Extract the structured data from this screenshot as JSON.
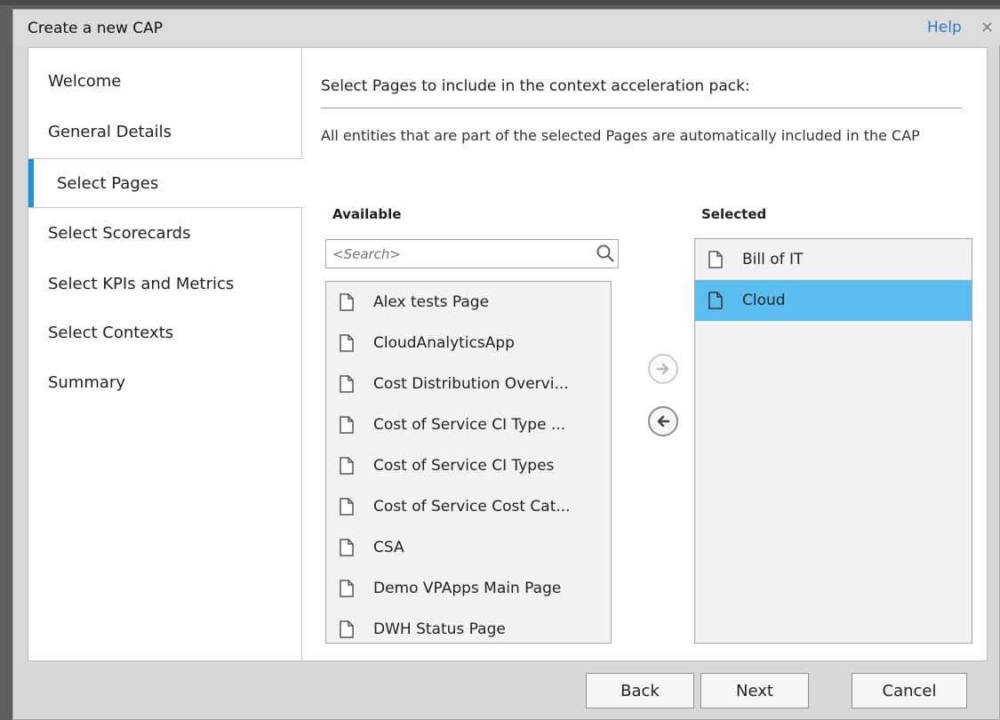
{
  "window": {
    "title": "Create a new CAP",
    "help_label": "Help",
    "close_label": "×"
  },
  "sidebar": {
    "items": [
      {
        "label": "Welcome"
      },
      {
        "label": "General Details"
      },
      {
        "label": "Select Pages"
      },
      {
        "label": "Select Scorecards"
      },
      {
        "label": "Select KPIs and Metrics"
      },
      {
        "label": "Select Contexts"
      },
      {
        "label": "Summary"
      }
    ],
    "active_label": "Select Pages"
  },
  "main": {
    "heading": "Select Pages to include in the context acceleration pack:",
    "note": "All entities that are part of the selected Pages are automatically included in the CAP",
    "available_label": "Available",
    "selected_label": "Selected",
    "search_placeholder": "<Search>",
    "available_items": [
      "Alex tests Page",
      "CloudAnalyticsApp",
      "Cost Distribution Overvi...",
      "Cost of Service CI Type ...",
      "Cost of Service CI Types",
      "Cost of Service Cost Cat...",
      "CSA",
      "Demo VPApps Main Page",
      "DWH Status Page"
    ],
    "selected_items": [
      "Bill of IT",
      "Cloud"
    ],
    "selected_highlight": "Cloud"
  },
  "footer": {
    "back_label": "Back",
    "next_label": "Next",
    "cancel_label": "Cancel"
  },
  "colors": {
    "accent": "#1f8ed8",
    "selection": "#5abff0",
    "link": "#2f77c8"
  },
  "icons": {
    "search": "search-icon",
    "page": "page-icon",
    "add": "arrow-right-icon",
    "remove": "arrow-left-icon",
    "close": "close-icon"
  }
}
